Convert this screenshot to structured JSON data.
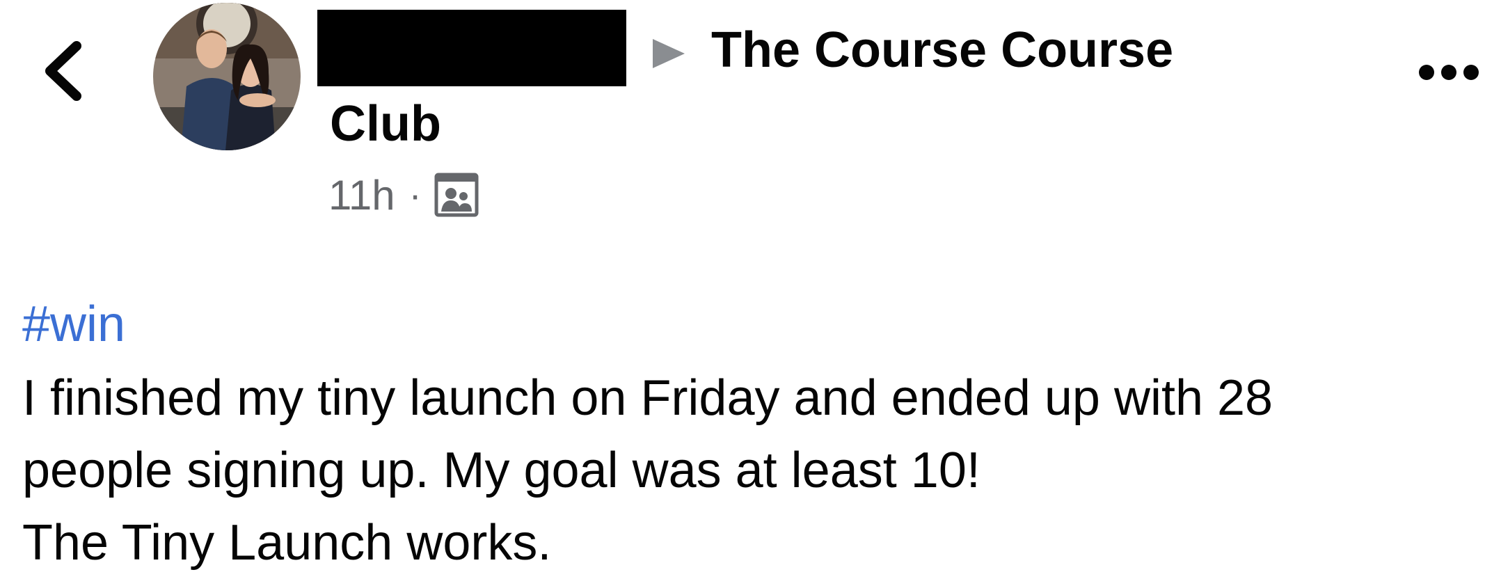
{
  "header": {
    "group_name_line1": "The Course Course",
    "group_name_line2": "Club",
    "back_icon": "chevron-left-icon",
    "separator_icon": "triangle-right-icon",
    "more_icon": "more-horizontal-icon"
  },
  "meta": {
    "time": "11h",
    "separator": "·",
    "audience_icon": "group-audience-icon"
  },
  "post": {
    "hashtag": "#win",
    "lines": [
      "I finished my tiny launch on Friday and ended up with 28",
      "people signing up. My goal was at least 10!",
      "The Tiny Launch works."
    ]
  },
  "colors": {
    "text": "#050505",
    "secondary_text": "#65676b",
    "hashtag_link": "#3b6fd4",
    "redaction": "#000000"
  }
}
